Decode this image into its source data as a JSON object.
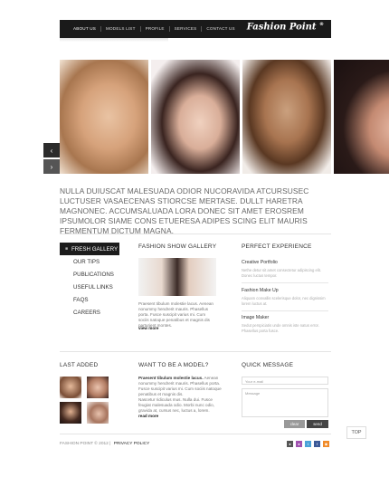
{
  "nav": {
    "links": [
      "About us",
      "Models list",
      "Profile",
      "Services",
      "Contact us"
    ],
    "logo": "Fashion Point",
    "logo_mark": "®"
  },
  "gallery": {
    "prev_label": "‹",
    "next_label": "›"
  },
  "intro": "Nulla duiuscat malesuada odior nucoravida atcursusec luctuser vasaecenas stiorcse mertase. Dullt haretra magnonec. Accumsaluada lora donec sit amet erosrem ipsumolor siame cons etueresa adipes scing elit mauris fermentum dictum magna.",
  "menu": {
    "items": [
      "Fresh gallery",
      "Our tips",
      "Publications",
      "Useful links",
      "FAQs",
      "Careers"
    ],
    "active_bullet": "■"
  },
  "show_gallery": {
    "title": "Fashion Show Gallery",
    "text": "Praesent tibulum molestie lacus. Aenean nonummy hendrerit mauris. Phasellus porta. Fusce suscipit varius mi. Cum sociis natoque penatibus et magnis dis parturient montes.",
    "more": "view more"
  },
  "experience": {
    "title": "Perfect Experience",
    "items": [
      {
        "title": "Creative Portfolio",
        "text": "Nethe detur sit amet consectetur adipiscing elit. Donec luctus tempor."
      },
      {
        "title": "Fashion Make Up",
        "text": "Aliquam convallis scelerisque dolor, nec dignissim lorem luctus at."
      },
      {
        "title": "Image Maker",
        "text": "Sedut perspiciatis unde omnis iste natus error. Phasellus porta fusce."
      }
    ]
  },
  "last_added": {
    "title": "Last added"
  },
  "model": {
    "title": "Want to be a model?",
    "lead": "Praesent tibulum molestie lacus.",
    "text1": "Aenean nonummy hendrerit mauris. Phasellus porta. Fusce suscipit varius mi. Cum sociis natoque penatibus et magnis dis.",
    "text2": "Nascetur ridiculus mus. Nulla dui. Fusce feugiat malesuada odio. Morbi nunc odio, gravida at, cursus nec, luctus a, lorem.",
    "more": "read more"
  },
  "quick_message": {
    "title": "Quick message",
    "email_placeholder": "Your e-mail",
    "message_placeholder": "Message",
    "clear_label": "clear",
    "send_label": "send"
  },
  "top_label": "TOP",
  "footer": {
    "copyright": "Fashion Point © 2012 |",
    "privacy": "Privacy Policy"
  },
  "social": [
    "●",
    "●",
    "t",
    "f",
    "◉"
  ],
  "colors": {
    "nav_bg": "#1a1a1a",
    "accent_dark": "#1c1c1c",
    "send_btn": "#444444",
    "clear_btn": "#999999"
  }
}
